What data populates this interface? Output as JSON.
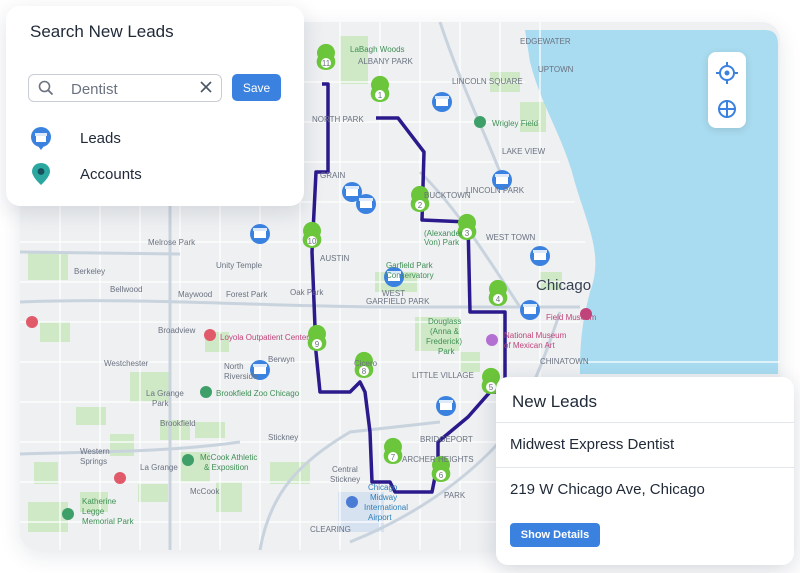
{
  "search_panel": {
    "title": "Search New Leads",
    "search_value": "Dentist",
    "save_label": "Save",
    "layers": [
      {
        "label": "Leads",
        "icon": "store-pin-icon",
        "color": "#3b82e0"
      },
      {
        "label": "Accounts",
        "icon": "location-pin-icon",
        "color": "#2aa8a0"
      }
    ]
  },
  "leads_card": {
    "title": "New Leads",
    "lead_name": "Midwest Express Dentist",
    "lead_address": "219 W Chicago Ave, Chicago",
    "details_label": "Show Details"
  },
  "map": {
    "route_color": "#2a1a8c",
    "stop_color": "#6cc63b",
    "lead_marker_color": "#3b82e0",
    "water_color": "#a9dcf0",
    "controls": [
      "locate-icon",
      "recenter-icon"
    ],
    "stops": [
      "1",
      "2",
      "3",
      "4",
      "5",
      "6",
      "7",
      "8",
      "9",
      "10",
      "11"
    ],
    "labels": {
      "la_bagh_woods": "LaBagh Woods",
      "albany_park": "ALBANY PARK",
      "lincoln_square": "LINCOLN SQUARE",
      "uptown": "UPTOWN",
      "edgewater": "EDGEWATER",
      "north_park": "NORTH PARK",
      "wrigley_field": "Wrigley Field",
      "lake_view": "LAKE VIEW",
      "lincoln_park": "LINCOLN PARK",
      "logan_square": "LOGAN SQUARE",
      "bucktown": "BUCKTOWN",
      "alexander": "(Alexander",
      "von_park": "Von) Park",
      "west_town": "WEST TOWN",
      "chicago": "Chicago",
      "melrose_park": "Melrose Park",
      "berkeley": "Berkeley",
      "bellwood": "Bellwood",
      "unity_temple": "Unity Temple",
      "maywood": "Maywood",
      "forest_park": "Forest Park",
      "oak_park": "Oak Park",
      "austin": "AUSTIN",
      "garfield_park": "Garfield Park",
      "conservatory": "Conservatory",
      "west": "WEST",
      "garfield_park_caps": "GARFIELD PARK",
      "field_museum": "Field Museum",
      "broadview": "Broadview",
      "loyola": "Loyola Outpatient Center",
      "douglass": "Douglass",
      "anna_frederick": "(Anna &",
      "frederick": "Frederick)",
      "park": "Park",
      "national_museum": "National Museum",
      "mexican_art": "of Mexican Art",
      "chinatown": "CHINATOWN",
      "westchester": "Westchester",
      "berwyn": "Berwyn",
      "north_riverside": "North",
      "riverside": "Riverside",
      "cicero": "Cicero",
      "little_village": "LITTLE VILLAGE",
      "la_grange_park": "La Grange",
      "park2": "Park",
      "brookfield_zoo": "Brookfield Zoo Chicago",
      "brookfield": "Brookfield",
      "bridgeport": "BRIDGEPORT",
      "stickney": "Stickney",
      "western_springs": "Western",
      "springs": "Springs",
      "la_grange": "La Grange",
      "mccook_athletic": "McCook Athletic",
      "exposition": "& Exposition",
      "archer_heights": "ARCHER HEIGHTS",
      "central_stickney": "Central",
      "stickney2": "Stickney",
      "mccook": "McCook",
      "chicago_midway": "Chicago",
      "midway": "Midway",
      "international": "International",
      "airport": "Airport",
      "katherine": "Katherine",
      "legge": "Legge",
      "memorial_park": "Memorial Park",
      "clearing": "CLEARING",
      "gage_park": "PARK",
      "hill": "HILL",
      "grain": "GRAIN"
    }
  }
}
